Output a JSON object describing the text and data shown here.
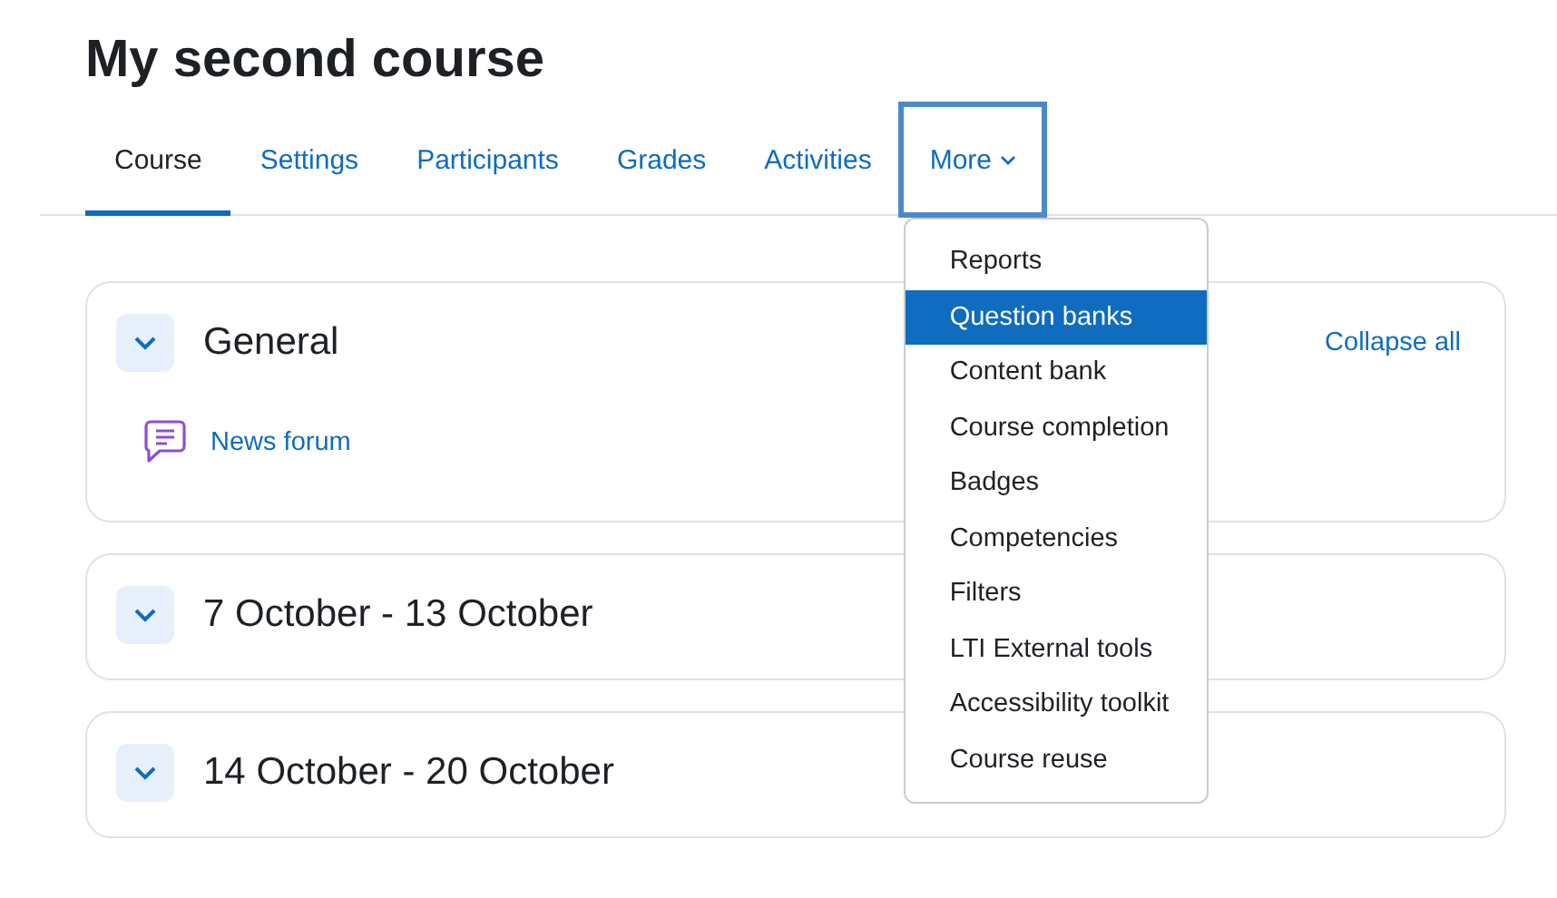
{
  "page_title": "My second course",
  "tabs": [
    {
      "label": "Course",
      "selected": true,
      "focused": false,
      "has_menu": false
    },
    {
      "label": "Settings",
      "selected": false,
      "focused": false,
      "has_menu": false
    },
    {
      "label": "Participants",
      "selected": false,
      "focused": false,
      "has_menu": false
    },
    {
      "label": "Grades",
      "selected": false,
      "focused": false,
      "has_menu": false
    },
    {
      "label": "Activities",
      "selected": false,
      "focused": false,
      "has_menu": false
    },
    {
      "label": "More",
      "selected": false,
      "focused": true,
      "has_menu": true
    }
  ],
  "more_menu": {
    "expanded": true,
    "items": [
      {
        "label": "Reports",
        "selected": false
      },
      {
        "label": "Question banks",
        "selected": true
      },
      {
        "label": "Content bank",
        "selected": false
      },
      {
        "label": "Course completion",
        "selected": false
      },
      {
        "label": "Badges",
        "selected": false
      },
      {
        "label": "Competencies",
        "selected": false
      },
      {
        "label": "Filters",
        "selected": false
      },
      {
        "label": "LTI External tools",
        "selected": false
      },
      {
        "label": "Accessibility toolkit",
        "selected": false
      },
      {
        "label": "Course reuse",
        "selected": false
      }
    ]
  },
  "collapse_all": "Collapse all",
  "sections": [
    {
      "title": "General",
      "expanded": true,
      "activities": [
        {
          "kind": "forum",
          "name": "News forum"
        }
      ]
    },
    {
      "title": "7 October - 13 October",
      "expanded": true
    },
    {
      "title": "14 October - 20 October",
      "expanded": true
    }
  ]
}
